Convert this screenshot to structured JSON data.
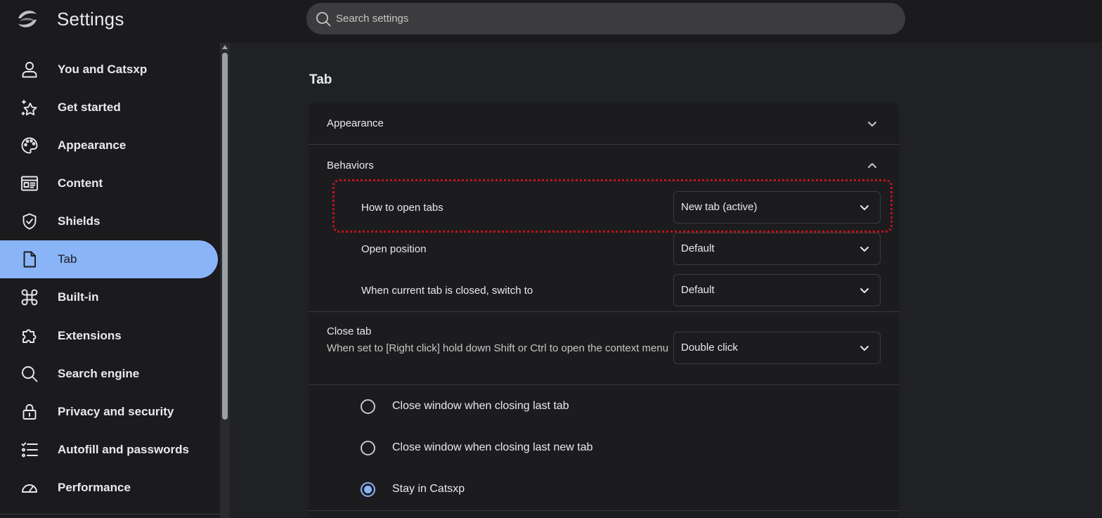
{
  "app": {
    "title": "Settings"
  },
  "search": {
    "placeholder": "Search settings"
  },
  "sidebar": {
    "items": [
      {
        "label": "You and Catsxp",
        "icon": "person-icon"
      },
      {
        "label": "Get started",
        "icon": "sparkle-star-icon"
      },
      {
        "label": "Appearance",
        "icon": "palette-icon"
      },
      {
        "label": "Content",
        "icon": "content-layout-icon"
      },
      {
        "label": "Shields",
        "icon": "shield-check-icon"
      },
      {
        "label": "Tab",
        "icon": "document-icon",
        "active": true
      },
      {
        "label": "Built-in",
        "icon": "command-key-icon"
      },
      {
        "label": "Extensions",
        "icon": "puzzle-icon"
      },
      {
        "label": "Search engine",
        "icon": "search-icon"
      },
      {
        "label": "Privacy and security",
        "icon": "lock-icon"
      },
      {
        "label": "Autofill and passwords",
        "icon": "checklist-icon"
      },
      {
        "label": "Performance",
        "icon": "gauge-icon"
      }
    ]
  },
  "main": {
    "section_title": "Tab",
    "appearance_label": "Appearance",
    "behaviors_label": "Behaviors",
    "how_to_open": {
      "label": "How to open tabs",
      "value": "New tab (active)"
    },
    "open_position": {
      "label": "Open position",
      "value": "Default"
    },
    "when_closed": {
      "label": "When current tab is closed, switch to",
      "value": "Default"
    },
    "close_tab": {
      "label": "Close tab",
      "description": "When set to [Right click] hold down Shift or Ctrl to open the context menu",
      "value": "Double click"
    },
    "radios": [
      {
        "label": "Close window when closing last tab",
        "checked": false
      },
      {
        "label": "Close window when closing last new tab",
        "checked": false
      },
      {
        "label": "Stay in Catsxp",
        "checked": true
      }
    ]
  },
  "colors": {
    "accent": "#8ab4f8",
    "highlight_outline": "#c0141c",
    "background": "#202124",
    "sidebar": "#1b1b1d"
  }
}
